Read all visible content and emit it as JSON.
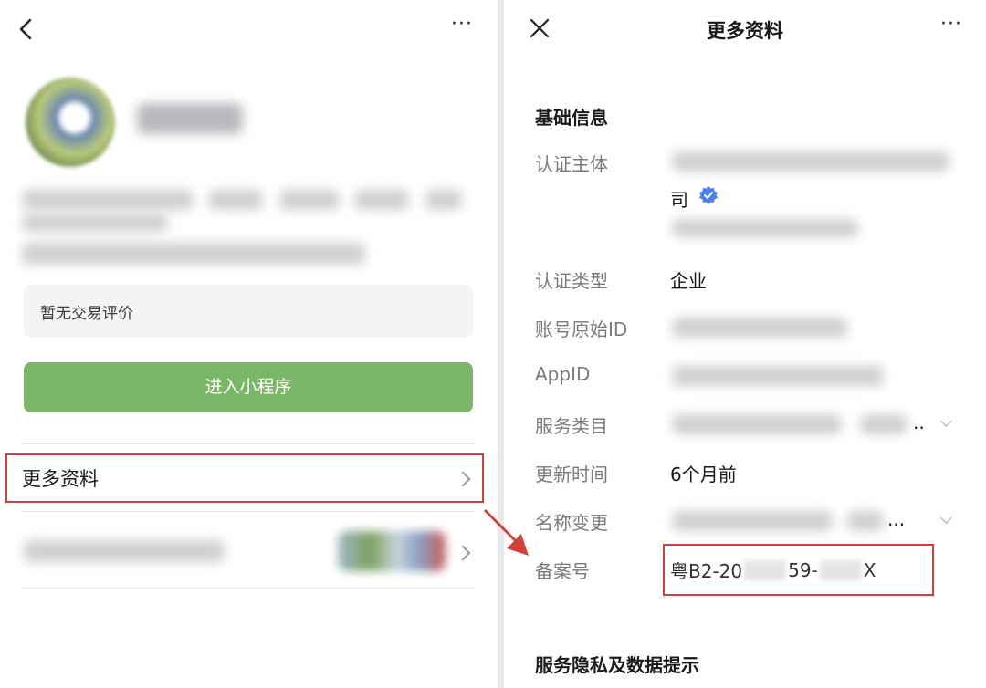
{
  "left": {
    "more_label": "···",
    "rating_text": "暂无交易评价",
    "enter_button": "进入小程序",
    "more_info_label": "更多资料"
  },
  "right": {
    "title": "更多资料",
    "more_label": "···",
    "section_basic": "基础信息",
    "rows": {
      "subject_label": "认证主体",
      "subject_value": "司",
      "type_label": "认证类型",
      "type_value": "企业",
      "origid_label": "账号原始ID",
      "appid_label": "AppID",
      "category_label": "服务类目",
      "category_ellipsis": "..",
      "update_label": "更新时间",
      "update_value": "6个月前",
      "rename_label": "名称变更",
      "rename_ellipsis": "...",
      "record_label": "备案号",
      "record_part1": "粤B2-20",
      "record_part2": "59-",
      "record_part3": "X"
    },
    "section_privacy": "服务隐私及数据提示"
  },
  "colors": {
    "accent_green": "#7bb566",
    "highlight_red": "#d2423c",
    "verified_blue": "#4a7ff0"
  }
}
